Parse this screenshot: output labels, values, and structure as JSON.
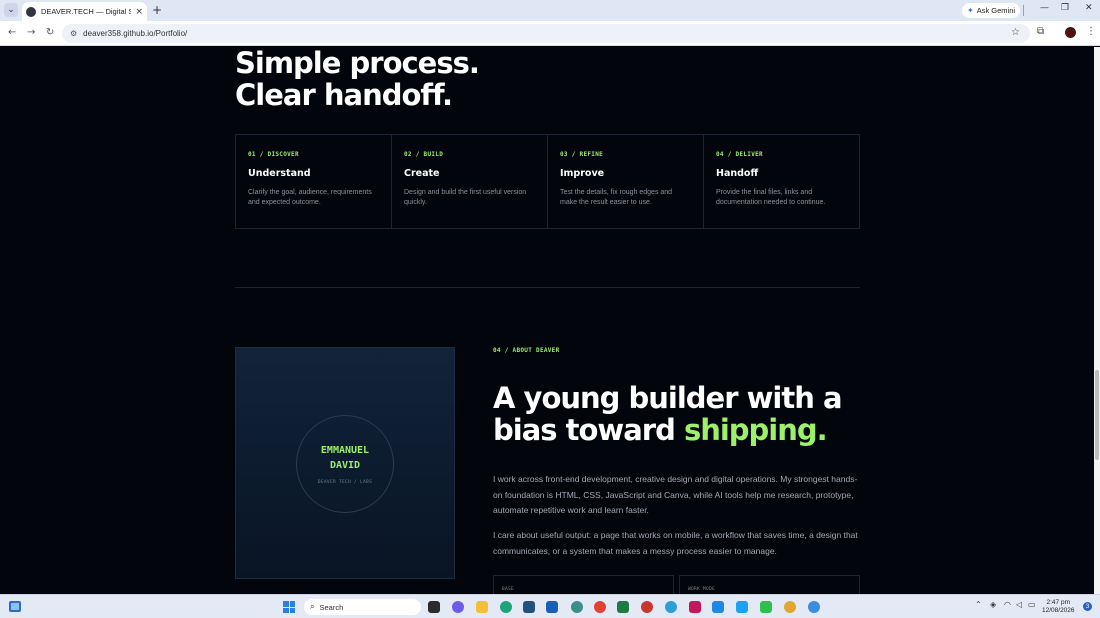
{
  "browser": {
    "tab_title": "DEAVER.TECH — Digital System",
    "tab_close": "×",
    "new_tab": "+",
    "ask_gemini": "Ask Gemini",
    "url": "deaver358.github.io/Portfolio/",
    "window_controls": {
      "minimize": "—",
      "restore": "❐",
      "close": "✕"
    }
  },
  "process": {
    "heading_line1": "Simple process.",
    "heading_line2": "Clear handoff.",
    "steps": [
      {
        "label": "01 / DISCOVER",
        "title": "Understand",
        "desc": "Clarify the goal, audience, requirements and expected outcome."
      },
      {
        "label": "02 / BUILD",
        "title": "Create",
        "desc": "Design and build the first useful version quickly."
      },
      {
        "label": "03 / REFINE",
        "title": "Improve",
        "desc": "Test the details, fix rough edges and make the result easier to use."
      },
      {
        "label": "04 / DELIVER",
        "title": "Handoff",
        "desc": "Provide the final files, links and documentation needed to continue."
      }
    ]
  },
  "about": {
    "portrait_name_line1": "EMMANUEL",
    "portrait_name_line2": "DAVID",
    "portrait_subtitle": "DEAVER TECH / LABS",
    "section_label": "04 / ABOUT DEAVER",
    "title_line1": "A young builder with a",
    "title_line2_prefix": "bias toward ",
    "title_line2_accent": "shipping.",
    "paragraph1": "I work across front-end development, creative design and digital operations. My strongest hands-on foundation is HTML, CSS, JavaScript and Canva, while AI tools help me research, prototype, automate repetitive work and learn faster.",
    "paragraph2": "I care about useful output: a page that works on mobile, a workflow that saves time, a design that communicates, or a system that makes a messy process easier to manage.",
    "card1_label": "BASE",
    "card2_label": "WORK MODE"
  },
  "taskbar": {
    "search_placeholder": "Search",
    "clock_time": "2:47 pm",
    "clock_date": "12/08/2026",
    "notifications": "3"
  },
  "colors": {
    "accent": "#9cf06a",
    "background": "#03050d",
    "border": "#1d2533"
  }
}
